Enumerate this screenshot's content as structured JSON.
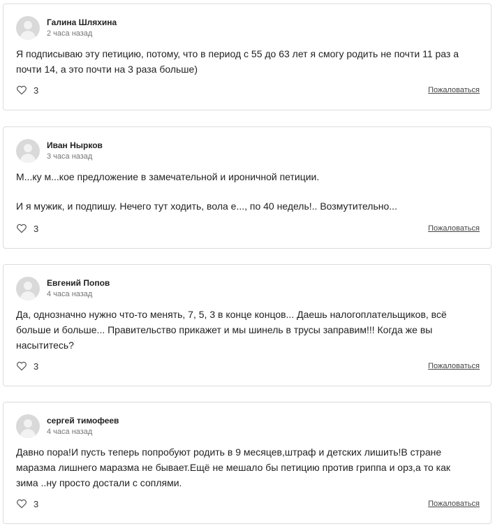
{
  "comments": [
    {
      "author": "Галина Шляхина",
      "time": "2 часа назад",
      "lines": [
        "Я подписываю эту петицию, потому, что в период с 55 до 63 лет я смогу родить не почти 11 раз а",
        "почти 14, а это почти на 3 раза больше)"
      ],
      "likes": "3",
      "report_label": "Пожаловаться"
    },
    {
      "author": "Иван Нырков",
      "time": "3 часа назад",
      "lines": [
        "М...ку м...кое предложение в замечательной и ироничной петиции.",
        "И я мужик, и подпишу. Нечего тут ходить, вола е..., по 40 недель!.. Возмутительно..."
      ],
      "likes": "3",
      "report_label": "Пожаловаться"
    },
    {
      "author": "Евгений Попов",
      "time": "4 часа назад",
      "lines": [
        "Да, однозначно нужно что-то менять, 7, 5, 3 в конце концов... Даешь налогоплательщиков, всё",
        "больше и больше... Правительство прикажет и мы шинель в трусы заправим!!! Когда же вы",
        "насытитесь?"
      ],
      "likes": "3",
      "report_label": "Пожаловаться"
    },
    {
      "author": "сергей тимофеев",
      "time": "4 часа назад",
      "lines": [
        "Давно пора!И пусть теперь попробуют родить в 9 месяцев,штраф и детских лишить!В стране",
        "маразма лишнего маразма не бывает.Ещё не мешало бы петицию против гриппа и орз,а то как",
        "зима ..ну просто достали с соплями."
      ],
      "likes": "3",
      "report_label": "Пожаловаться"
    }
  ],
  "icons": {
    "like": "heart-icon",
    "avatar": "user-silhouette-icon"
  },
  "colors": {
    "border": "#dcdcdc",
    "avatar": "#d9d9d9",
    "meta_text": "#757575"
  }
}
